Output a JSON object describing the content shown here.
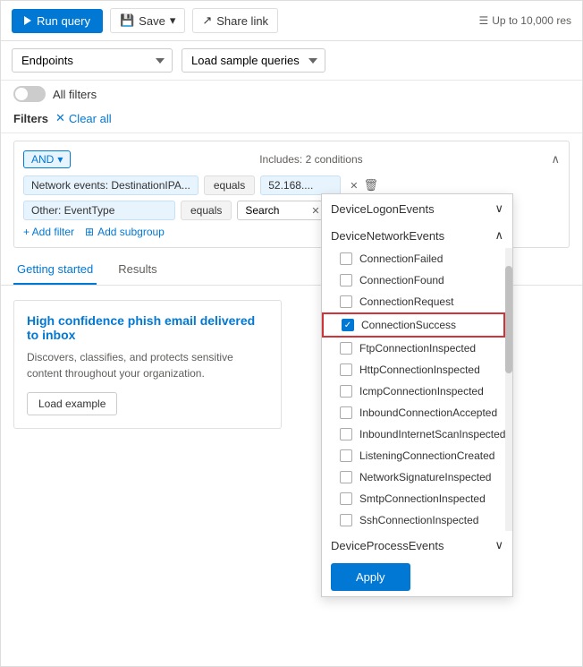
{
  "toolbar": {
    "run_query_label": "Run query",
    "save_label": "Save",
    "share_link_label": "Share link",
    "results_hint": "Up to 10,000 res"
  },
  "dropdowns": {
    "endpoints_label": "Endpoints",
    "sample_queries_label": "Load sample queries"
  },
  "toggle": {
    "label": "All filters"
  },
  "filters_bar": {
    "label": "Filters",
    "clear_all_label": "Clear all"
  },
  "conditions": {
    "and_label": "AND",
    "includes_label": "Includes: 2 conditions",
    "rows": [
      {
        "field": "Network events: DestinationIPA...",
        "operator": "equals",
        "value": "52.168...."
      },
      {
        "field": "Other: EventType",
        "operator": "equals",
        "value": "Search"
      }
    ],
    "add_filter_label": "+ Add filter",
    "add_subgroup_label": "Add subgroup"
  },
  "event_dropdown": {
    "sections": [
      {
        "name": "DeviceLogonEvents",
        "expanded": false,
        "items": []
      },
      {
        "name": "DeviceNetworkEvents",
        "expanded": true,
        "items": [
          {
            "label": "ConnectionFailed",
            "checked": false
          },
          {
            "label": "ConnectionFound",
            "checked": false
          },
          {
            "label": "ConnectionRequest",
            "checked": false
          },
          {
            "label": "ConnectionSuccess",
            "checked": true,
            "highlighted": true
          },
          {
            "label": "FtpConnectionInspected",
            "checked": false
          },
          {
            "label": "HttpConnectionInspected",
            "checked": false
          },
          {
            "label": "IcmpConnectionInspected",
            "checked": false
          },
          {
            "label": "InboundConnectionAccepted",
            "checked": false
          },
          {
            "label": "InboundInternetScanInspected",
            "checked": false
          },
          {
            "label": "ListeningConnectionCreated",
            "checked": false
          },
          {
            "label": "NetworkSignatureInspected",
            "checked": false
          },
          {
            "label": "SmtpConnectionInspected",
            "checked": false
          },
          {
            "label": "SshConnectionInspected",
            "checked": false
          }
        ]
      },
      {
        "name": "DeviceProcessEvents",
        "expanded": false,
        "items": []
      }
    ],
    "apply_label": "Apply"
  },
  "tabs": [
    {
      "label": "Getting started",
      "active": true
    },
    {
      "label": "Results",
      "active": false
    }
  ],
  "card": {
    "title": "High confidence phish email delivered to inbox",
    "desc": "Discovers, classifies, and protects sensitive content throughout your organization.",
    "load_example_label": "Load example"
  }
}
